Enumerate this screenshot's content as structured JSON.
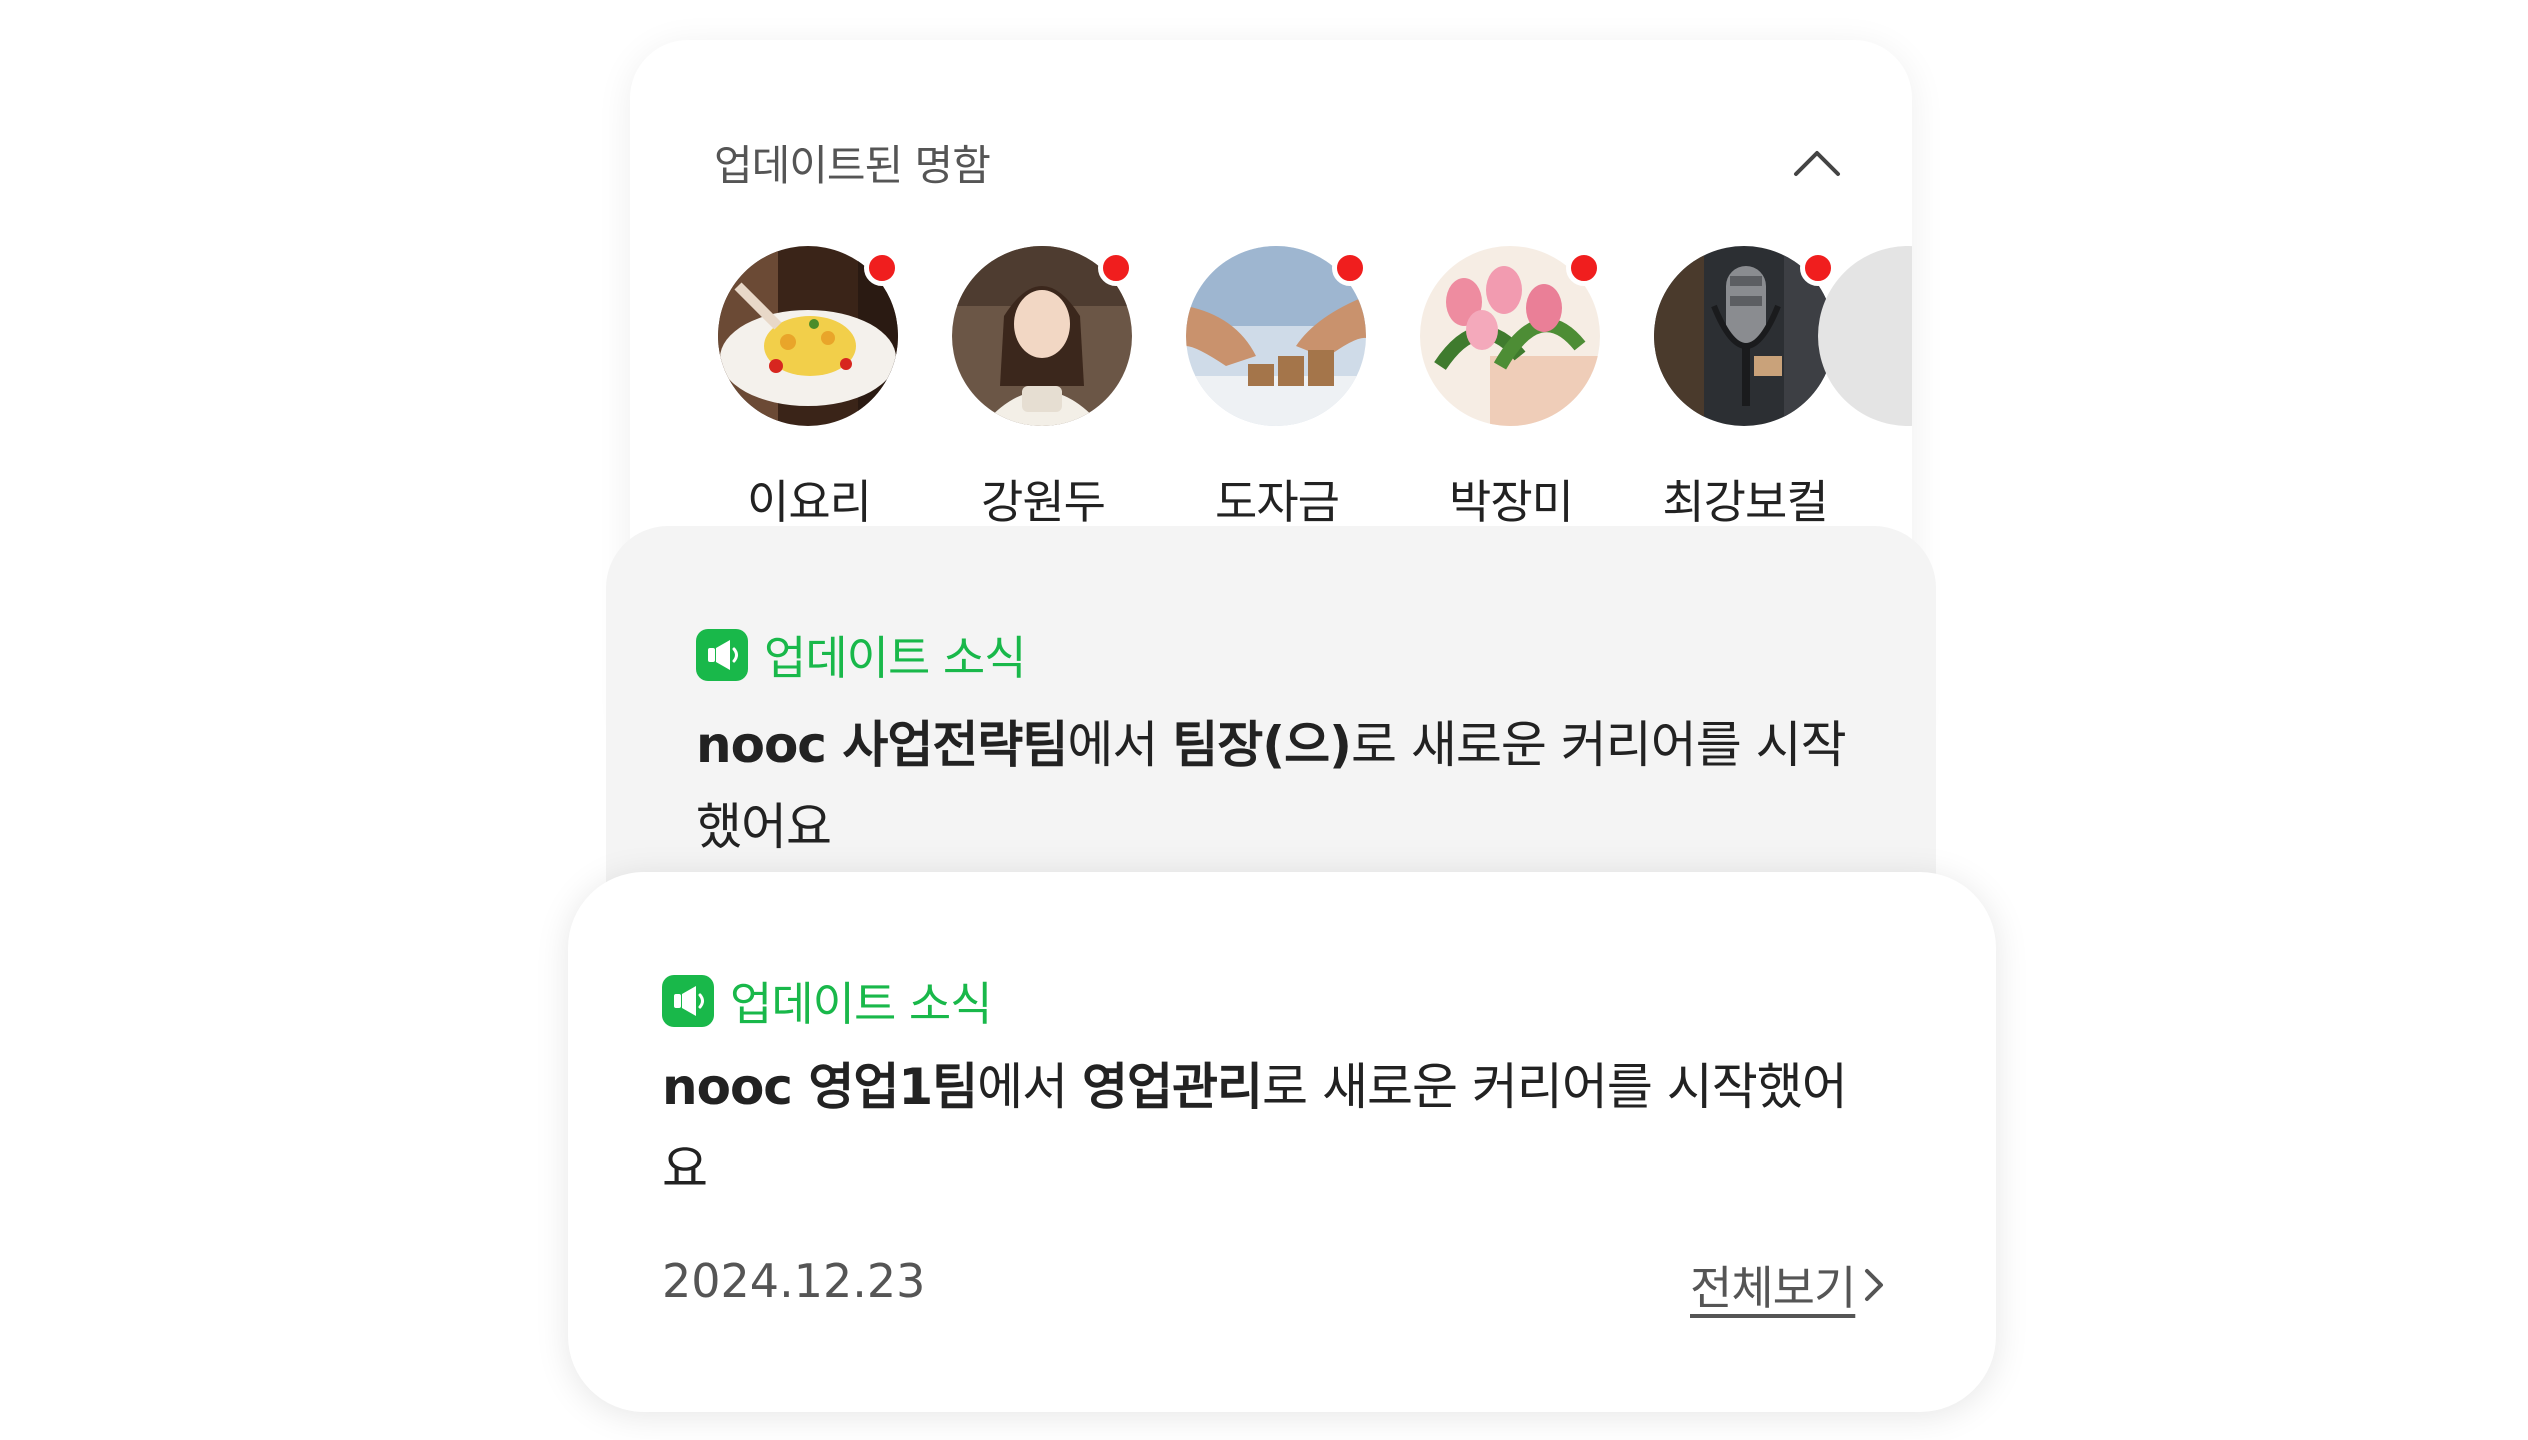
{
  "top_card": {
    "title": "업데이트된 명함",
    "collapse_icon": "chevron-up-icon",
    "people": [
      {
        "name": "이요리",
        "avatar": "pasta-dish-photo",
        "has_update": true
      },
      {
        "name": "강원두",
        "avatar": "barista-woman-photo",
        "has_update": true
      },
      {
        "name": "도자금",
        "avatar": "coin-stacks-photo",
        "has_update": true
      },
      {
        "name": "박장미",
        "avatar": "tulip-flowers-photo",
        "has_update": true
      },
      {
        "name": "최강보컬",
        "avatar": "studio-microphone-photo",
        "has_update": true
      }
    ]
  },
  "news_back": {
    "label": "업데이트 소식",
    "icon": "megaphone-icon",
    "text_parts": {
      "company": "nooc 사업전략팀",
      "p1": "에서 ",
      "role": "팀장(으)",
      "p2": "로 새로운 커리어를 시작",
      "line2": "했어요"
    }
  },
  "news_front": {
    "label": "업데이트 소식",
    "icon": "megaphone-icon",
    "text_parts": {
      "company": "nooc 영업1팀",
      "p1": "에서 ",
      "role": "영업관리",
      "p2": "로 새로운 커리어를 시작했어",
      "line2": "요"
    },
    "date": "2024.12.23",
    "view_all": "전체보기",
    "view_all_icon": "chevron-right-icon"
  },
  "colors": {
    "accent_green": "#19b84a",
    "badge_red": "#f01e1e",
    "card_grey": "#f4f4f4"
  }
}
